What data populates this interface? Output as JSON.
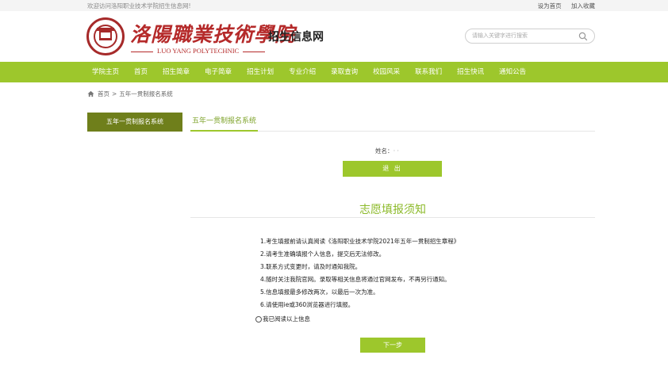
{
  "topbar": {
    "welcome": "欢迎访问洛阳职业技术学院招生信息网!",
    "set_home": "设为首页",
    "add_fav": "加入收藏"
  },
  "header": {
    "logo_cn": "洛陽職業技術學院",
    "logo_en": "LUO YANG  POLYTECHNIC",
    "site_name": "招生信息网",
    "search_placeholder": "请输入关键字进行搜索",
    "search_icon": "search-icon"
  },
  "nav": {
    "items": [
      "学院主页",
      "首页",
      "招生简章",
      "电子简章",
      "招生计划",
      "专业介绍",
      "录取查询",
      "校园风采",
      "联系我们",
      "招生快讯",
      "通知公告"
    ]
  },
  "breadcrumb": {
    "home": "首页",
    "separator": ">",
    "current": "五年一贯制报名系统"
  },
  "sidebar": {
    "tab": "五年一贯制报名系统"
  },
  "main": {
    "title": "五年一贯制报名系统",
    "name_label": "姓名：",
    "name_value": "· ·",
    "logout_label": "退 出",
    "notice_title": "志愿填报须知",
    "rules": [
      "1.考生填报前请认真阅读《洛阳职业技术学院2021年五年一贯制招生章程》",
      "2.请考生准确填报个人信息，提交后无法修改。",
      "3.联系方式变更时，请及时通知我院。",
      "4.随时关注我院官网。录取等相关信息将通过官网发布，不再另行通知。",
      "5.信息填报最多修改两次，以最后一次为准。",
      "6.请使用ie或360浏览器进行填报。"
    ],
    "agree_label": "我已阅读以上信息",
    "next_label": "下一步"
  },
  "colors": {
    "nav_green": "#9dc72c",
    "side_tab_olive": "#6f7f1b",
    "brand_red": "#b52a2a"
  }
}
